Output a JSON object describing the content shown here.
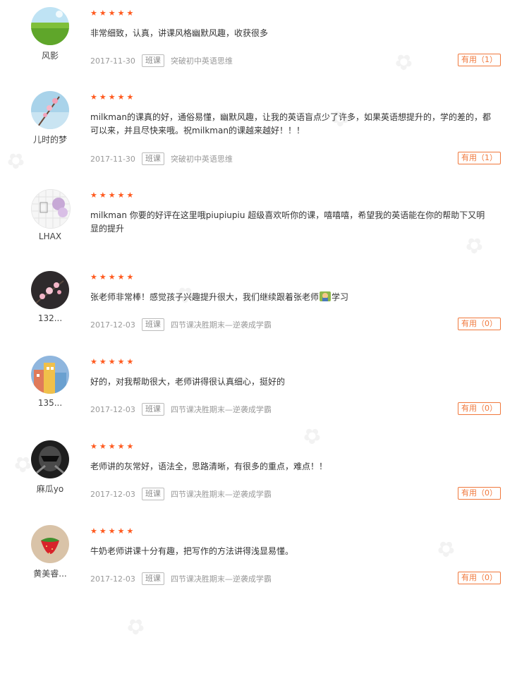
{
  "reviews": [
    {
      "user": "风影",
      "stars": "★★★★★",
      "text": "非常细致，认真，讲课风格幽默风趣，收获很多",
      "date": "2017-11-30",
      "tag": "班课",
      "course": "突破初中英语思维",
      "useful": "有用（1）"
    },
    {
      "user": "儿时的梦",
      "stars": "★★★★★",
      "text": "milkman的课真的好，通俗易懂，幽默风趣，让我的英语盲点少了许多，如果英语想提升的，学的差的，都可以来，并且尽快来哦。祝milkman的课越来越好！！！",
      "date": "2017-11-30",
      "tag": "班课",
      "course": "突破初中英语思维",
      "useful": "有用（1）"
    },
    {
      "user": "LHAX",
      "stars": "★★★★★",
      "text": "milkman 你要的好评在这里哦piupiupiu 超级喜欢听你的课，嘻嘻嘻，希望我的英语能在你的帮助下又明显的提升"
    },
    {
      "user": "132...",
      "stars": "★★★★★",
      "text_before": "张老师非常棒！感觉孩子兴趣提升很大，我们继续跟着张老师",
      "text_after": "学习",
      "date": "2017-12-03",
      "tag": "班课",
      "course": "四节课决胜期末—逆袭成学霸",
      "useful": "有用（0）"
    },
    {
      "user": "135...",
      "stars": "★★★★★",
      "text": "好的，对我帮助很大，老师讲得很认真细心，挺好的",
      "date": "2017-12-03",
      "tag": "班课",
      "course": "四节课决胜期末—逆袭成学霸",
      "useful": "有用（0）"
    },
    {
      "user": "麻瓜yo",
      "stars": "★★★★★",
      "text": "老师讲的灰常好，语法全，思路清晰，有很多的重点，难点！！",
      "date": "2017-12-03",
      "tag": "班课",
      "course": "四节课决胜期末—逆袭成学霸",
      "useful": "有用（0）"
    },
    {
      "user": "黄美睿...",
      "stars": "★★★★★",
      "text": "牛奶老师讲课十分有趣，把写作的方法讲得浅显易懂。",
      "date": "2017-12-03",
      "tag": "班课",
      "course": "四节课决胜期末—逆袭成学霸",
      "useful": "有用（0）"
    }
  ],
  "colors": {
    "star": "#ff5a1f",
    "useful": "#f0783c",
    "meta": "#999999"
  },
  "icons": [
    "avatar-landscape",
    "avatar-flower",
    "avatar-sketch",
    "avatar-blossom",
    "avatar-buildings",
    "avatar-helmet",
    "avatar-strawberry",
    "emoji-teacher-icon"
  ]
}
